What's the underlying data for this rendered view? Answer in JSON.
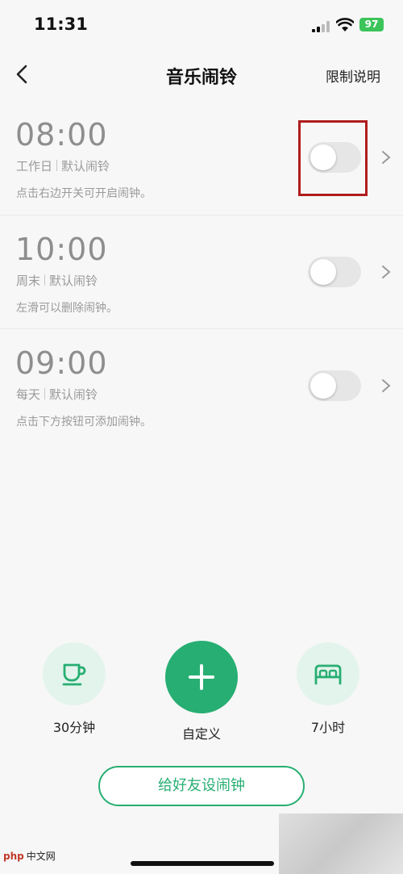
{
  "status_bar": {
    "time": "11:31",
    "battery": "97"
  },
  "nav": {
    "title": "音乐闹铃",
    "right_action": "限制说明"
  },
  "alarms": [
    {
      "time": "08:00",
      "repeat": "工作日",
      "sound": "默认闹铃",
      "hint": "点击右边开关可开启闹钟。",
      "enabled": false
    },
    {
      "time": "10:00",
      "repeat": "周末",
      "sound": "默认闹铃",
      "hint": "左滑可以删除闹钟。",
      "enabled": false
    },
    {
      "time": "09:00",
      "repeat": "每天",
      "sound": "默认闹铃",
      "hint": "点击下方按钮可添加闹钟。",
      "enabled": false
    }
  ],
  "quick_actions": {
    "nap_label": "30分钟",
    "custom_label": "自定义",
    "sleep_label": "7小时"
  },
  "friend_button": "给好友设闹钟",
  "watermark": {
    "brand": "php",
    "site": "中文网"
  },
  "colors": {
    "accent": "#27ae72",
    "accent_light": "#e3f4ec",
    "highlight": "#b01c1c",
    "toggle_off": "#e6e6e6"
  }
}
